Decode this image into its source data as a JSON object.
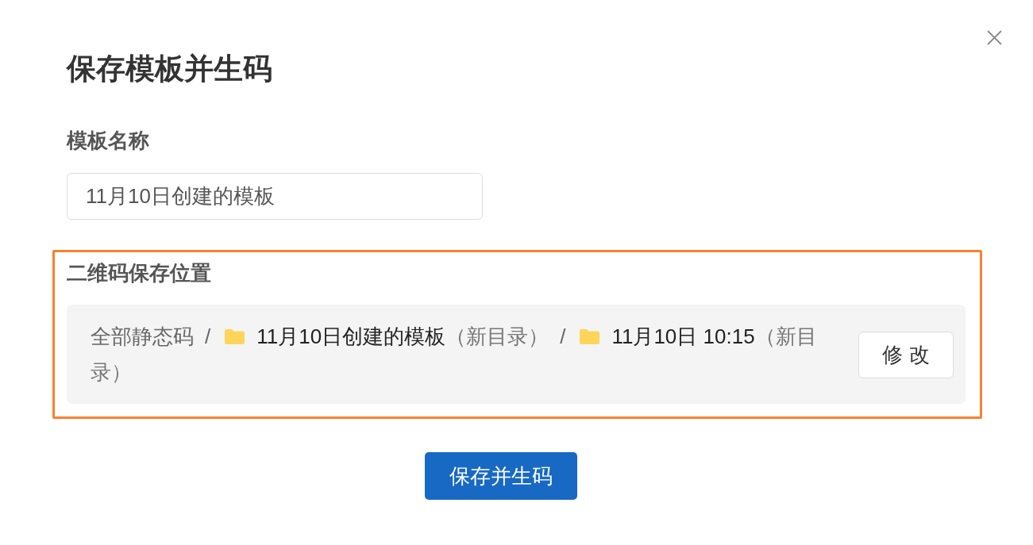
{
  "dialog": {
    "title": "保存模板并生码",
    "template_name": {
      "label": "模板名称",
      "value": "11月10日创建的模板"
    },
    "qr_location": {
      "label": "二维码保存位置",
      "highlighted": true,
      "path": [
        {
          "kind": "root",
          "text": "全部静态码"
        },
        {
          "kind": "separator",
          "text": "/"
        },
        {
          "kind": "folder",
          "name": "11月10日创建的模板",
          "note": "（新目录）"
        },
        {
          "kind": "separator",
          "text": "/"
        },
        {
          "kind": "folder",
          "name": "11月10日 10:15",
          "note": "（新目录）"
        }
      ],
      "change_button": "修 改"
    },
    "submit_button": "保存并生码"
  }
}
